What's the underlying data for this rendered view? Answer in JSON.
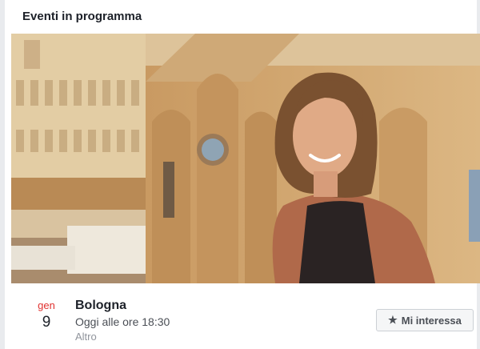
{
  "section_title": "Eventi in programma",
  "event": {
    "month": "gen",
    "day": "9",
    "title": "Bologna",
    "time": "Oggi alle ore 18:30",
    "category": "Altro",
    "interest_label": "Mi interessa",
    "interest_icon": "star-icon"
  },
  "colors": {
    "month_red": "#e0312f",
    "text_dark": "#1d2129",
    "text_gray": "#90949c"
  }
}
